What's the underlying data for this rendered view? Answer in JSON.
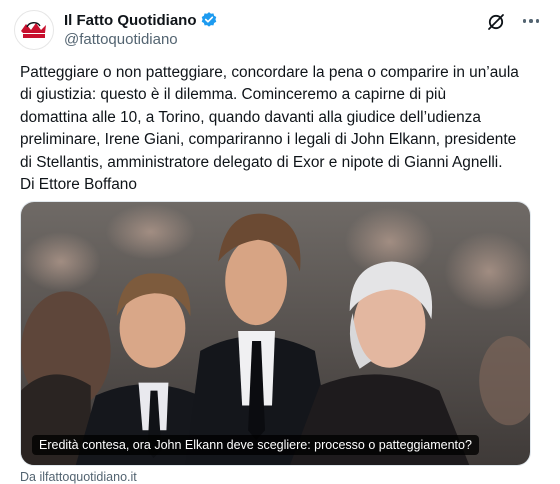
{
  "tweet": {
    "display_name": "Il Fatto Quotidiano",
    "handle": "@fattoquotidiano",
    "verified": true,
    "text": "Patteggiare o non patteggiare, concordare la pena o comparire in un’aula\ndi giustizia: questo è il dilemma. Cominceremo a capirne di più\ndomattina alle 10, a Torino, quando davanti alla giudice dell’udienza\npreliminare, Irene Giani, compariranno i legali di John Elkann, presidente\ndi Stellantis, amministratore delegato di Exor e nipote di Gianni Agnelli.\nDi Ettore Boffano"
  },
  "header_icons": {
    "grok": "grok-icon",
    "more": "more-icon",
    "verified": "verified-badge-icon"
  },
  "card": {
    "title": "Eredità contesa, ora John Elkann deve scegliere: processo o patteggiamento?",
    "domain": "Da ilfattoquotidiano.it"
  },
  "colors": {
    "verified": "#1d9bf0",
    "text": "#0f1419",
    "secondary": "#536471",
    "logo_red": "#c8102e"
  }
}
